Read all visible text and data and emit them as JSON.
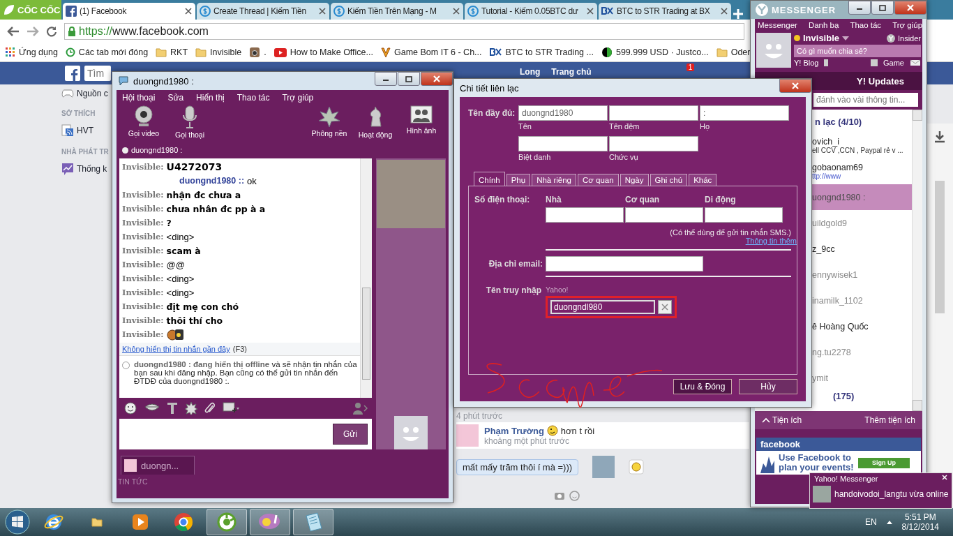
{
  "browser": {
    "brand": "CỐC CỐC",
    "tabs": [
      {
        "title": "(1) Facebook",
        "selected": true
      },
      {
        "title": "Create Thread | Kiếm Tiền",
        "selected": false
      },
      {
        "title": "Kiếm Tiền Trên Mạng - M",
        "selected": false
      },
      {
        "title": "Tutorial - Kiếm 0.05BTC dư",
        "selected": false
      },
      {
        "title": "BTC to STR Trading at BX",
        "selected": false
      }
    ],
    "url_scheme": "https://",
    "url_host": "www.facebook.com",
    "bookmarks": [
      {
        "label": "Ứng dụng"
      },
      {
        "label": "Các tab mới đóng"
      },
      {
        "label": "RKT"
      },
      {
        "label": "Invisible"
      },
      {
        "label": "."
      },
      {
        "label": "How to Make Office..."
      },
      {
        "label": "Game Bom IT 6 - Ch..."
      },
      {
        "label": "BTC to STR Trading ..."
      },
      {
        "label": "599.999 USD · Justco..."
      },
      {
        "label": "Oder"
      }
    ]
  },
  "facebook": {
    "search_placeholder": "Tìm",
    "header_items": [
      "Long",
      "Trang chủ"
    ],
    "notification_count": "1",
    "sidebar": [
      {
        "kind": "item",
        "label": "Nguồn c"
      },
      {
        "kind": "heading",
        "label": "SỞ THÍCH"
      },
      {
        "kind": "item",
        "label": "HVT"
      },
      {
        "kind": "heading",
        "label": "NHÀ PHÁT TR"
      },
      {
        "kind": "item",
        "label": "Thống k"
      }
    ],
    "feed": {
      "time_1": "4 phút trước",
      "author": "Phạm Trường",
      "text": "hơn t rồi",
      "time_2": "khoảng một phút trước",
      "bubble": "mất mấy trăm thôi í mà =)))"
    }
  },
  "chat_window": {
    "title": "duongnd1980 :",
    "menu": [
      "Hội thoại",
      "Sửa",
      "Hiển thị",
      "Thao tác",
      "Trợ giúp"
    ],
    "tools_left": [
      "Gọi video",
      "Gọi thoại"
    ],
    "tools_right": [
      "Phông nền",
      "Hoạt động",
      "Hình ảnh"
    ],
    "contact_status": "duongnd1980 :",
    "messages": [
      {
        "sender": "Invisible:",
        "kind": "large",
        "text": "U4272073"
      },
      {
        "sender": "duongnd1980 ::",
        "kind": "contact",
        "text": "ok"
      },
      {
        "sender": "Invisible:",
        "kind": "bold",
        "text": "nhận đc chưa a"
      },
      {
        "sender": "Invisible:",
        "kind": "bold",
        "text": "chưa nhân đc pp à a"
      },
      {
        "sender": "Invisible:",
        "kind": "bold",
        "text": "?"
      },
      {
        "sender": "Invisible:",
        "kind": "plain",
        "text": "<ding>"
      },
      {
        "sender": "Invisible:",
        "kind": "bold",
        "text": "scam à"
      },
      {
        "sender": "Invisible:",
        "kind": "plain",
        "text": "@@"
      },
      {
        "sender": "Invisible:",
        "kind": "plain",
        "text": "<ding>"
      },
      {
        "sender": "Invisible:",
        "kind": "plain",
        "text": "<ding>"
      },
      {
        "sender": "Invisible:",
        "kind": "bold",
        "text": "địt mẹ con chó"
      },
      {
        "sender": "Invisible:",
        "kind": "bold",
        "text": "thôi thí cho"
      },
      {
        "sender": "Invisible:",
        "kind": "emoticon"
      }
    ],
    "hide_link": "Không hiển thị tin nhắn gần đây",
    "hide_shortcut": "(F3)",
    "offline_notice": "**duongnd1980 : đang hiển thị offline** và sẽ nhận tin nhắn của bạn sau khi đăng nhập. Bạn cũng có thể gửi tin nhắn đến ĐTDĐ của duongnd1980 :.",
    "send": "Gửi",
    "conversation_tab": "duongn...",
    "news": "TIN TỨC"
  },
  "contact_dialog": {
    "title": "Chi tiết liên lạc",
    "full_name_label": "Tên đầy đủ:",
    "name_fields": [
      {
        "label": "Tên",
        "value": "duongnd1980"
      },
      {
        "label": "Tên đệm"
      },
      {
        "label": "Họ",
        "value": ":"
      }
    ],
    "extra_fields": [
      {
        "label": "Biệt danh"
      },
      {
        "label": "Chức vụ"
      }
    ],
    "tabs": [
      {
        "label": "Chính",
        "selected": true
      },
      {
        "label": "Phụ",
        "selected": false
      },
      {
        "label": "Nhà riêng",
        "selected": false
      },
      {
        "label": "Cơ quan",
        "selected": false
      },
      {
        "label": "Ngày",
        "selected": false
      },
      {
        "label": "Ghi chú",
        "selected": false
      },
      {
        "label": "Khác",
        "selected": false
      }
    ],
    "phone_label": "Số điện thoại:",
    "phone_columns": [
      "Nhà",
      "Cơ quan",
      "Di động"
    ],
    "sms_note": "(Có thể dùng để gửi tin nhắn SMS.)",
    "more_link": "Thông tin thêm",
    "email_label": "Địa chỉ email:",
    "login_label": "Tên truy nhập",
    "login_service": "Yahoo!",
    "login_value": "duongndl980",
    "buttons": [
      {
        "label": "Lưu & Đóng",
        "kind": "primary"
      },
      {
        "label": "Hủy",
        "kind": "secondary"
      }
    ]
  },
  "messenger": {
    "title": "MESSENGER",
    "menu": [
      "Messenger",
      "Danh bạ",
      "Thao tác",
      "Trợ giúp"
    ],
    "status": "Invisible",
    "insider": "Insider",
    "status_placeholder": "Có gì muốn chia sẻ?",
    "blog": "Y! Blog",
    "game": "Game",
    "updates_tab": "Y! Updates",
    "search_placeholder": "đánh vào vài thông tin...",
    "group": "n lạc (4/10)",
    "contacts": [
      {
        "name": "ovich_i",
        "status": "ell CCV ,CCN , Paypal rẻ v ...",
        "online": true,
        "selected": false
      },
      {
        "name": "gobaonam69",
        "status": "ttp://www",
        "online": true,
        "selected": false
      },
      {
        "name": "uongnd1980 :",
        "online": false,
        "selected": true
      },
      {
        "name": "uildgold9",
        "online": false,
        "selected": false
      },
      {
        "name": "z_9cc",
        "online": true,
        "selected": false
      },
      {
        "name": "ennywisek1",
        "online": false,
        "selected": false
      },
      {
        "name": "inamilk_1102",
        "online": false,
        "selected": false
      },
      {
        "name": "ê Hoàng Quốc",
        "online": true,
        "selected": false
      },
      {
        "name": "ng.tu2278",
        "online": false,
        "selected": false
      },
      {
        "name": "ymit",
        "online": false,
        "selected": false
      }
    ],
    "group_2": "(175)",
    "plugins": "Tiện ích",
    "more_plugins": "Thêm tiện ích",
    "ad": {
      "brand": "facebook",
      "text": "Use Facebook to plan your events!",
      "button": "Sign Up"
    }
  },
  "toast": {
    "title": "Yahoo! Messenger",
    "text": "handoivodoi_langtu vừa online"
  },
  "taskbar": {
    "apps": [
      {
        "selected": false
      },
      {
        "selected": false
      },
      {
        "selected": false
      },
      {
        "selected": false
      },
      {
        "selected": true
      },
      {
        "selected": true
      },
      {
        "selected": true
      }
    ],
    "language": "EN",
    "time": "5:51 PM",
    "date": "8/12/2014"
  }
}
